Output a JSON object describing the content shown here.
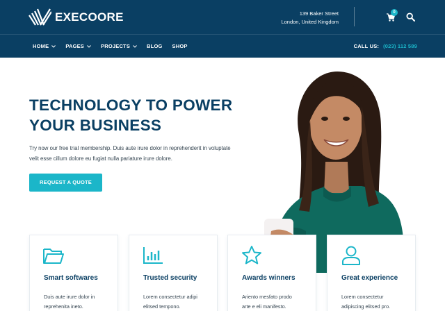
{
  "brand": {
    "name": "EXECOORE",
    "logo_icon": "striped-logo-icon"
  },
  "contact": {
    "address_line1": "139 Baker Street",
    "address_line2": "London, United Kingdom",
    "cart_count": "0"
  },
  "nav": {
    "items": [
      {
        "label": "HOME",
        "has_dropdown": true
      },
      {
        "label": "PAGES",
        "has_dropdown": true
      },
      {
        "label": "PROJECTS",
        "has_dropdown": true
      },
      {
        "label": "BLOG",
        "has_dropdown": false
      },
      {
        "label": "SHOP",
        "has_dropdown": false
      }
    ],
    "call_label": "CALL US:",
    "phone": "(023) 112 589"
  },
  "hero": {
    "title_line1": "TECHNOLOGY TO POWER",
    "title_line2": "YOUR BUSINESS",
    "text_line1": "Try now our free trial membership. Duis aute irure dolor in reprehenderit in voluptate",
    "text_line2": "velit esse cillum dolore eu fugiat nulla pariature irure dolore.",
    "cta_label": "REQUEST A QUOTE"
  },
  "features": [
    {
      "icon": "folder-icon",
      "title": "Smart softwares",
      "text_line1": "Duis aute irure dolor in",
      "text_line2": "reprehenita ineto."
    },
    {
      "icon": "bar-chart-icon",
      "title": "Trusted security",
      "text_line1": "Lorem consectetur adipi",
      "text_line2": "elitsed tempono."
    },
    {
      "icon": "star-icon",
      "title": "Awards winners",
      "text_line1": "Ariento mesfato prodo",
      "text_line2": "arte e eli manifesto."
    },
    {
      "icon": "user-icon",
      "title": "Great experience",
      "text_line1": "Lorem consectetur",
      "text_line2": "adipiscing elitsed pro."
    }
  ],
  "colors": {
    "navy": "#0a3f63",
    "accent": "#1bb6c9",
    "text": "#33434f"
  }
}
